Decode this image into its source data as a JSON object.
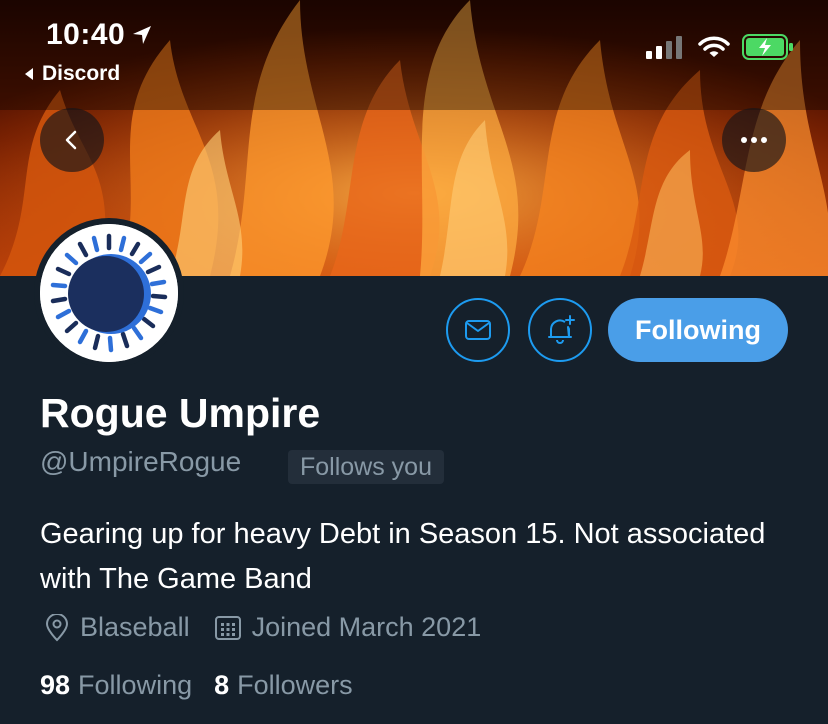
{
  "status_bar": {
    "time": "10:40",
    "back_app": "Discord"
  },
  "header": {
    "back_icon": "chevron-left-icon",
    "more_icon": "ellipsis-icon"
  },
  "actions": {
    "message_icon": "envelope-icon",
    "notify_icon": "bell-plus-icon",
    "follow_label": "Following"
  },
  "profile": {
    "name": "Rogue Umpire",
    "handle": "@UmpireRogue",
    "follows_you": "Follows you",
    "bio": "Gearing up for heavy Debt in Season 15. Not associated with The Game Band",
    "location": "Blaseball",
    "joined": "Joined March 2021",
    "following_count": "98",
    "following_label": "Following",
    "followers_count": "8",
    "followers_label": "Followers"
  },
  "colors": {
    "background": "#15202b",
    "accent": "#1d9bf0",
    "follow_button": "#4a9ee8",
    "secondary_text": "#8899a6"
  }
}
